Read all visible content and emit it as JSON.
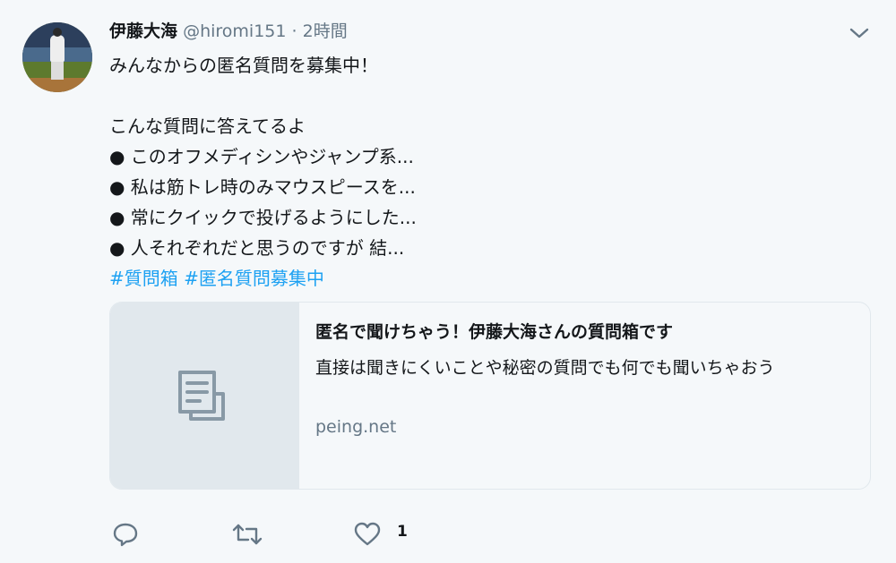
{
  "tweet": {
    "display_name": "伊藤大海",
    "handle": "@hiromi151",
    "separator": "·",
    "time": "2時間",
    "lines": [
      "みんなからの匿名質問を募集中！",
      "",
      "こんな質問に答えてるよ",
      "● このオフメディシンやジャンプ系...",
      "● 私は筋トレ時のみマウスピースを...",
      "● 常にクイックで投げるようにした...",
      "● 人それぞれだと思うのですが 結..."
    ],
    "hashtags": [
      "#質問箱",
      "#匿名質問募集中"
    ]
  },
  "card": {
    "title": "匿名で聞けちゃう！伊藤大海さんの質問箱です",
    "description": "直接は聞きにくいことや秘密の質問でも何でも聞いちゃおう",
    "domain": "peing.net",
    "thumbnail_icon": "document-icon"
  },
  "actions": {
    "reply_icon": "reply-icon",
    "retweet_icon": "retweet-icon",
    "like_icon": "heart-icon",
    "like_count": "1"
  },
  "colors": {
    "background": "#f5f8fa",
    "text": "#14171a",
    "muted": "#657786",
    "link": "#1da1f2",
    "card_border": "#e1e8ed"
  }
}
